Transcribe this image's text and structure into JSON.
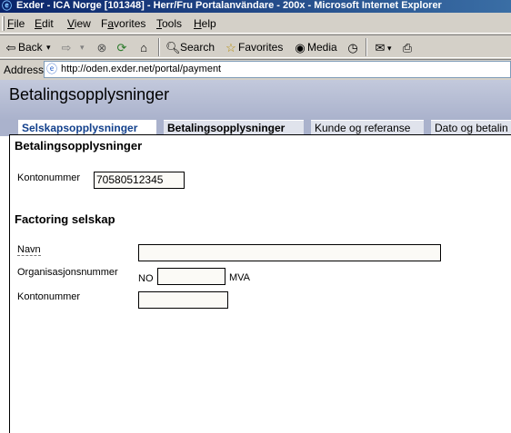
{
  "window": {
    "title": "Exder - ICA Norge [101348] - Herr/Fru Portalanvändare - 200x - Microsoft Internet Explorer",
    "icon": "ie-icon"
  },
  "menu": {
    "items": [
      "File",
      "Edit",
      "View",
      "Favorites",
      "Tools",
      "Help"
    ],
    "mnemonics": [
      "F",
      "E",
      "V",
      "a",
      "T",
      "H"
    ]
  },
  "toolbar": {
    "back_label": "Back",
    "search_label": "Search",
    "favorites_label": "Favorites",
    "media_label": "Media"
  },
  "address": {
    "label": "Address",
    "url": "http://oden.exder.net/portal/payment"
  },
  "page": {
    "title": "Betalingsopplysninger",
    "tabs": [
      "Selskapsopplysninger",
      "Betalingsopplysninger",
      "Kunde og referanse",
      "Dato og betalin"
    ]
  },
  "form": {
    "section1_title": "Betalingsopplysninger",
    "account_label": "Kontonummer",
    "account_value": "70580512345",
    "section2_title": "Factoring selskap",
    "name_label": "Navn",
    "name_value": "",
    "orgnr_label": "Organisasjonsnummer",
    "orgnr_prefix": "NO",
    "orgnr_value": "",
    "orgnr_suffix": "MVA",
    "factoring_account_label": "Kontonummer",
    "factoring_account_value": ""
  }
}
